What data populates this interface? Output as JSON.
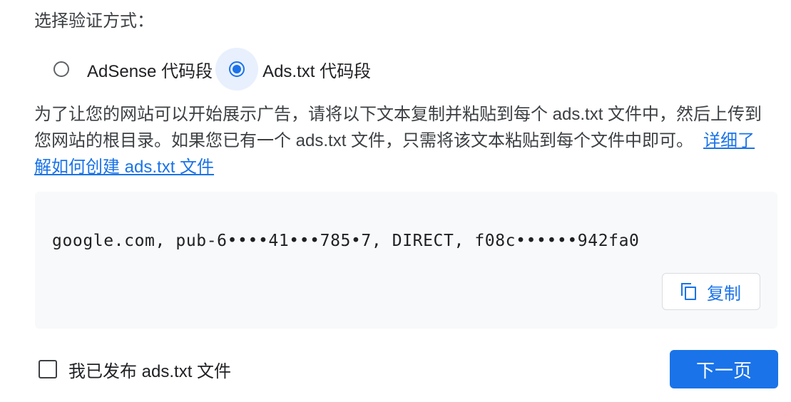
{
  "title": "选择验证方式：",
  "verification_options": [
    {
      "label": "AdSense 代码段",
      "selected": false
    },
    {
      "label": "Ads.txt 代码段",
      "selected": true
    }
  ],
  "description": "为了让您的网站可以开始展示广告，请将以下文本复制并粘贴到每个 ads.txt 文件中，然后上传到您网站的根目录。如果您已有一个 ads.txt 文件，只需将该文本粘贴到每个文件中即可。",
  "learn_more_link": "详细了解如何创建 ads.txt 文件",
  "code_snippet": "google.com, pub-6••••41•••785•7, DIRECT, f08c••••••942fa0",
  "copy_button": "复制",
  "published_checkbox": {
    "label": "我已发布 ads.txt 文件",
    "checked": false
  },
  "next_button": "下一页",
  "colors": {
    "accent": "#1a73e8",
    "code_background": "#f8f9fa",
    "selected_radio_halo": "#e8f0fe"
  },
  "icons": {
    "copy": "copy-icon",
    "radio_selected": "radio-selected-icon",
    "radio_unselected": "radio-unselected-icon",
    "checkbox": "checkbox-unchecked-icon"
  }
}
